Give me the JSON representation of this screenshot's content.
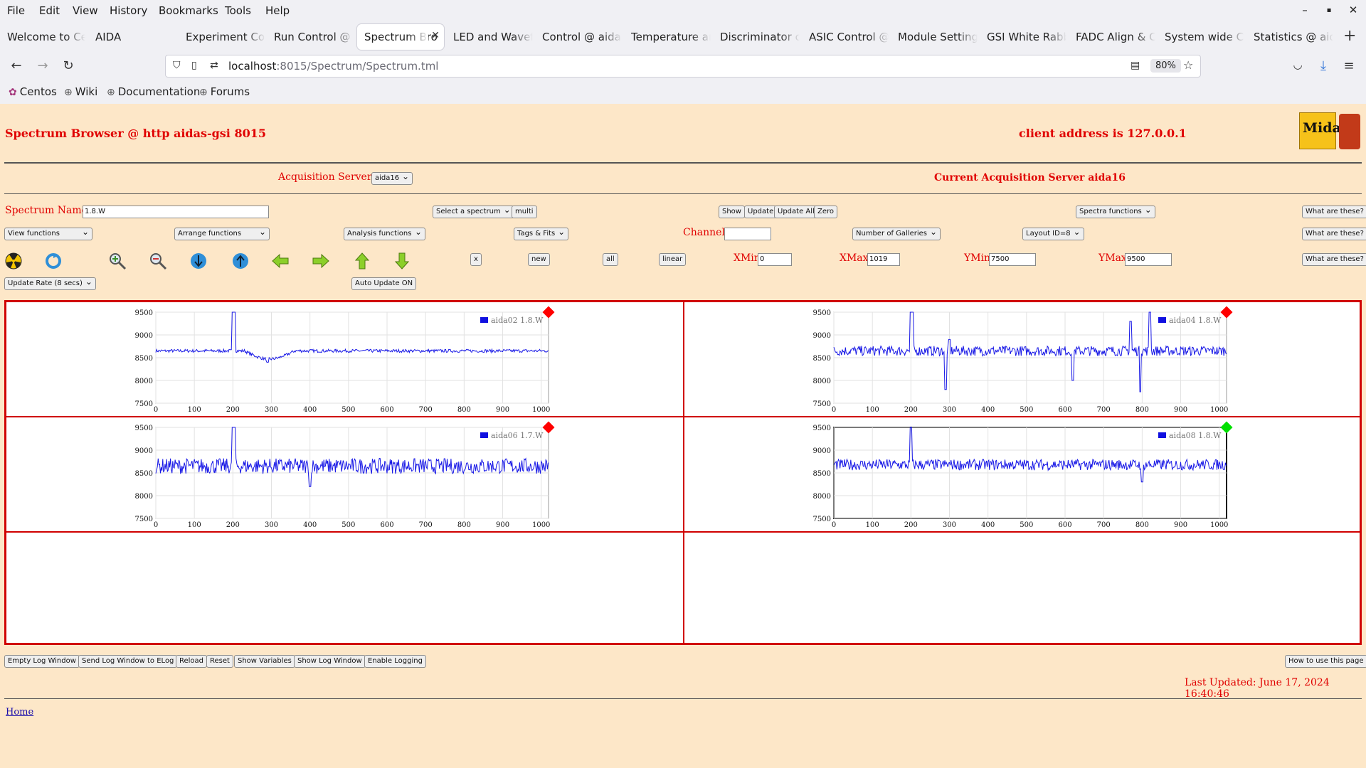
{
  "browser": {
    "menu": [
      "File",
      "Edit",
      "View",
      "History",
      "Bookmarks",
      "Tools",
      "Help"
    ],
    "window_controls": [
      "–",
      "▪",
      "✕"
    ],
    "tabs": [
      "Welcome to Ce",
      "AIDA",
      "Experiment Cont",
      "Run Control @ a",
      "Spectrum Bro",
      "LED and Wavefo",
      "Control @ aidas",
      "Temperature an",
      "Discriminator co",
      "ASIC Control @",
      "Module Settings",
      "GSI White Rabbi",
      "FADC Align & C",
      "System wide Ch",
      "Statistics @ aid"
    ],
    "active_tab_index": 4,
    "url_host": "localhost",
    "url_rest": ":8015/Spectrum/Spectrum.tml",
    "zoom": "80%",
    "bookmarks": [
      "Centos",
      "Wiki",
      "Documentation",
      "Forums"
    ]
  },
  "page": {
    "title": "Spectrum Browser @ http aidas-gsi 8015",
    "client_address": "client address is 127.0.0.1",
    "acq_servers_label": "Acquisition Servers",
    "acq_server_value": "aida16",
    "current_server": "Current Acquisition Server aida16",
    "spectrum_name_label": "Spectrum Name:",
    "spectrum_name_value": "1.8.W",
    "select_spectrum": "Select a spectrum",
    "multi": "multi",
    "show": "Show",
    "update": "Update",
    "update_all": "Update All",
    "zero": "Zero",
    "spectra_functions": "Spectra functions",
    "what_are_these": "What are these?",
    "view_functions": "View functions",
    "arrange_functions": "Arrange functions",
    "analysis_functions": "Analysis functions",
    "tags_fits": "Tags & Fits",
    "channel_label": "Channel:",
    "channel_value": "",
    "num_galleries": "Number of Galleries",
    "layout_id": "Layout ID=8",
    "x_btn": "x",
    "new_btn": "new",
    "all_btn": "all",
    "linear_btn": "linear",
    "xmin_label": "XMin",
    "xmin_value": "0",
    "xmax_label": "XMax",
    "xmax_value": "1019",
    "ymin_label": "YMin",
    "ymin_value": "7500",
    "ymax_label": "YMax",
    "ymax_value": "9500",
    "update_rate": "Update Rate (8 secs)",
    "auto_update": "Auto Update ON",
    "bottom_buttons": [
      "Empty Log Window",
      "Send Log Window to ELog",
      "Reload",
      "Reset",
      "Show Variables",
      "Show Log Window",
      "Enable Logging"
    ],
    "how_to": "How to use this page",
    "last_updated": "Last Updated: June 17, 2024 16:40:46",
    "home_link": "Home"
  },
  "chart_data": [
    {
      "type": "line",
      "title": "",
      "series": [
        {
          "name": "aida02 1.8.W"
        }
      ],
      "xlim": [
        0,
        1019
      ],
      "ylim": [
        7500,
        9500
      ],
      "xticks": [
        0,
        100,
        200,
        300,
        400,
        500,
        600,
        700,
        800,
        900,
        1000
      ],
      "yticks": [
        7500,
        8000,
        8500,
        9000,
        9500
      ],
      "baseline": 8650,
      "noise": 35,
      "features": [
        {
          "x": 200,
          "y": 9500
        },
        {
          "x": 205,
          "y": 9500
        },
        {
          "x": 290,
          "y": 8400
        },
        {
          "x": 260,
          "y": 8520
        },
        {
          "x": 330,
          "y": 8530
        }
      ],
      "status_color": "#ff0000",
      "grid": true
    },
    {
      "type": "line",
      "title": "",
      "series": [
        {
          "name": "aida04 1.8.W"
        }
      ],
      "xlim": [
        0,
        1019
      ],
      "ylim": [
        7500,
        9500
      ],
      "xticks": [
        0,
        100,
        200,
        300,
        400,
        500,
        600,
        700,
        800,
        900,
        1000
      ],
      "yticks": [
        7500,
        8000,
        8500,
        9000,
        9500
      ],
      "baseline": 8650,
      "noise": 110,
      "features": [
        {
          "x": 200,
          "y": 9500
        },
        {
          "x": 204,
          "y": 9500
        },
        {
          "x": 290,
          "y": 7800
        },
        {
          "x": 300,
          "y": 8900
        },
        {
          "x": 620,
          "y": 8000
        },
        {
          "x": 770,
          "y": 9300
        },
        {
          "x": 795,
          "y": 7750
        },
        {
          "x": 820,
          "y": 9500
        }
      ],
      "status_color": "#ff0000",
      "grid": true
    },
    {
      "type": "line",
      "title": "",
      "series": [
        {
          "name": "aida06 1.7.W"
        }
      ],
      "xlim": [
        0,
        1019
      ],
      "ylim": [
        7500,
        9500
      ],
      "xticks": [
        0,
        100,
        200,
        300,
        400,
        500,
        600,
        700,
        800,
        900,
        1000
      ],
      "yticks": [
        7500,
        8000,
        8500,
        9000,
        9500
      ],
      "baseline": 8650,
      "noise": 170,
      "features": [
        {
          "x": 200,
          "y": 9500
        },
        {
          "x": 204,
          "y": 9500
        },
        {
          "x": 400,
          "y": 8200
        }
      ],
      "status_color": "#ff0000",
      "grid": true
    },
    {
      "type": "line",
      "title": "",
      "series": [
        {
          "name": "aida08 1.8.W"
        }
      ],
      "xlim": [
        0,
        1019
      ],
      "ylim": [
        7500,
        9500
      ],
      "xticks": [
        0,
        100,
        200,
        300,
        400,
        500,
        600,
        700,
        800,
        900,
        1000
      ],
      "yticks": [
        7500,
        8000,
        8500,
        9000,
        9500
      ],
      "baseline": 8680,
      "noise": 120,
      "features": [
        {
          "x": 200,
          "y": 9500
        },
        {
          "x": 800,
          "y": 8300
        }
      ],
      "status_color": "#00e000",
      "grid": true,
      "selected": true
    }
  ]
}
